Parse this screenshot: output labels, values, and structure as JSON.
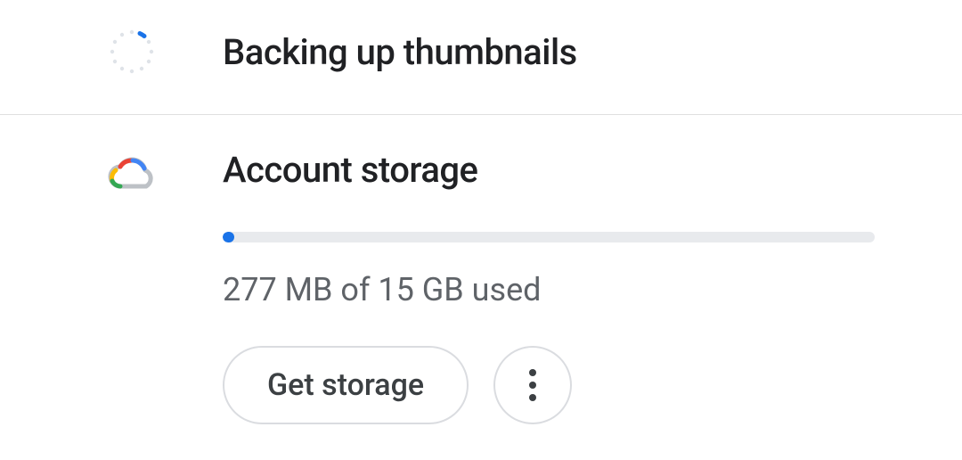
{
  "backup": {
    "title": "Backing up thumbnails"
  },
  "storage": {
    "title": "Account storage",
    "usage_text": "277 MB of 15 GB used",
    "used_mb": 277,
    "total_gb": 15,
    "progress_percent": 1.8,
    "get_storage_label": "Get storage"
  },
  "colors": {
    "accent": "#1a73e8",
    "text_secondary": "#5f6368",
    "border": "#dadce0",
    "track": "#e8eaed"
  }
}
